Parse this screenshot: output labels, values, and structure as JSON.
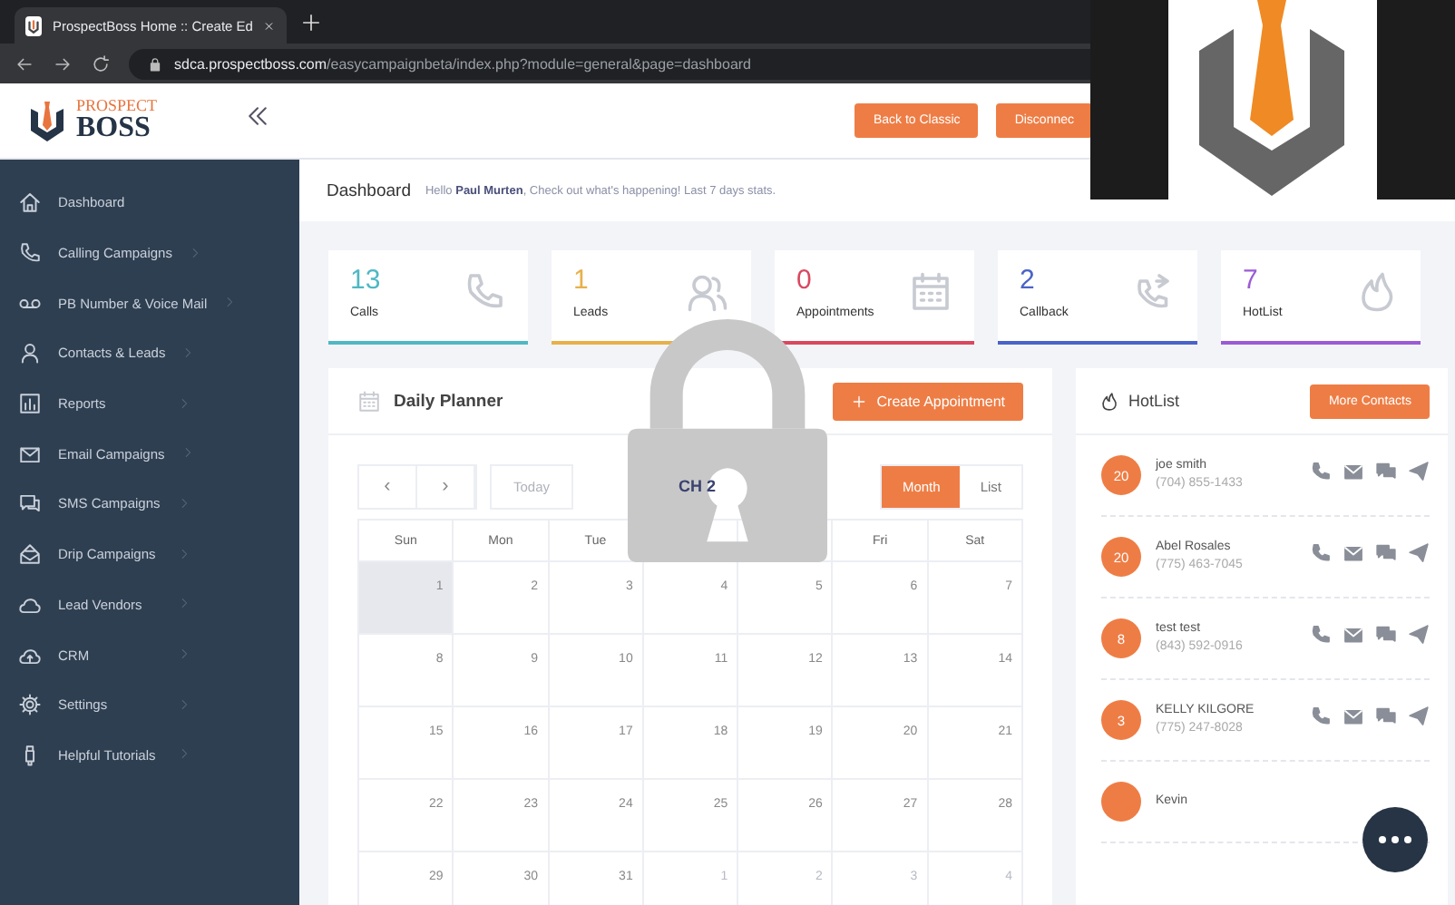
{
  "browser": {
    "tab_title": "ProspectBoss Home :: Create Ed",
    "url_host": "sdca.prospectboss.com",
    "url_path": "/easycampaignbeta/index.php?module=general&page=dashboard"
  },
  "header": {
    "logo_top": "PROSPECT",
    "logo_bottom": "BOSS",
    "buttons": [
      "Back to Classic",
      "Disconnec"
    ]
  },
  "sidebar": {
    "items": [
      {
        "label": "Dashboard",
        "submenu": false
      },
      {
        "label": "Calling Campaigns",
        "submenu": true
      },
      {
        "label": "PB Number & Voice Mail",
        "submenu": true
      },
      {
        "label": "Contacts & Leads",
        "submenu": true
      },
      {
        "label": "Reports",
        "submenu": true
      },
      {
        "label": "Email Campaigns",
        "submenu": true
      },
      {
        "label": "SMS Campaigns",
        "submenu": true
      },
      {
        "label": "Drip Campaigns",
        "submenu": true
      },
      {
        "label": "Lead Vendors",
        "submenu": true
      },
      {
        "label": "CRM",
        "submenu": true
      },
      {
        "label": "Settings",
        "submenu": true
      },
      {
        "label": "Helpful Tutorials",
        "submenu": true
      }
    ]
  },
  "page": {
    "title": "Dashboard",
    "greeting": "Hello **Paul Murten**, Check out what's happening! Last 7 days stats."
  },
  "stats": [
    {
      "value": "13",
      "label": "Calls",
      "color": "#4fb8c4"
    },
    {
      "value": "1",
      "label": "Leads",
      "color": "#e8b04a"
    },
    {
      "value": "0",
      "label": "Appointments",
      "color": "#d9485f"
    },
    {
      "value": "2",
      "label": "Callback",
      "color": "#4a63c8"
    },
    {
      "value": "7",
      "label": "HotList",
      "color": "#9b5bd6"
    }
  ],
  "planner": {
    "title": "Daily Planner",
    "create_button": "Create Appointment",
    "prev": "‹",
    "next": "›",
    "today": "Today",
    "month_title": "CH 2",
    "views": [
      {
        "label": "Month",
        "selected": true
      },
      {
        "label": "List",
        "selected": false
      }
    ],
    "weekdays_left": [
      "Sun",
      "Mon",
      "Tue"
    ],
    "weekdays_right": [
      "Fri",
      "Sat"
    ],
    "weeks": [
      [
        {
          "day": "1",
          "today": true,
          "muted": false
        },
        {
          "day": "2",
          "today": false,
          "muted": false
        },
        {
          "day": "3",
          "today": false,
          "muted": false
        },
        {
          "day": "4",
          "today": false,
          "muted": false
        },
        {
          "day": "5",
          "today": false,
          "muted": false
        },
        {
          "day": "6",
          "today": false,
          "muted": false
        },
        {
          "day": "7",
          "today": false,
          "muted": false
        }
      ],
      [
        {
          "day": "8",
          "today": false,
          "muted": false
        },
        {
          "day": "9",
          "today": false,
          "muted": false
        },
        {
          "day": "10",
          "today": false,
          "muted": false
        },
        {
          "day": "11",
          "today": false,
          "muted": false
        },
        {
          "day": "12",
          "today": false,
          "muted": false
        },
        {
          "day": "13",
          "today": false,
          "muted": false
        },
        {
          "day": "14",
          "today": false,
          "muted": false
        }
      ],
      [
        {
          "day": "15",
          "today": false,
          "muted": false
        },
        {
          "day": "16",
          "today": false,
          "muted": false
        },
        {
          "day": "17",
          "today": false,
          "muted": false
        },
        {
          "day": "18",
          "today": false,
          "muted": false
        },
        {
          "day": "19",
          "today": false,
          "muted": false
        },
        {
          "day": "20",
          "today": false,
          "muted": false
        },
        {
          "day": "21",
          "today": false,
          "muted": false
        }
      ],
      [
        {
          "day": "22",
          "today": false,
          "muted": false
        },
        {
          "day": "23",
          "today": false,
          "muted": false
        },
        {
          "day": "24",
          "today": false,
          "muted": false
        },
        {
          "day": "25",
          "today": false,
          "muted": false
        },
        {
          "day": "26",
          "today": false,
          "muted": false
        },
        {
          "day": "27",
          "today": false,
          "muted": false
        },
        {
          "day": "28",
          "today": false,
          "muted": false
        }
      ],
      [
        {
          "day": "29",
          "today": false,
          "muted": false
        },
        {
          "day": "30",
          "today": false,
          "muted": false
        },
        {
          "day": "31",
          "today": false,
          "muted": false
        },
        {
          "day": "1",
          "today": false,
          "muted": true
        },
        {
          "day": "2",
          "today": false,
          "muted": true
        },
        {
          "day": "3",
          "today": false,
          "muted": true
        },
        {
          "day": "4",
          "today": false,
          "muted": true
        }
      ]
    ]
  },
  "hotlist": {
    "title": "HotList",
    "more_button": "More Contacts",
    "contacts": [
      {
        "score": "20",
        "name": "joe smith",
        "phone": "(704) 855-1433"
      },
      {
        "score": "20",
        "name": "Abel Rosales",
        "phone": "(775) 463-7045"
      },
      {
        "score": "8",
        "name": "test test",
        "phone": "(843) 592-0916"
      },
      {
        "score": "3",
        "name": "KELLY KILGORE",
        "phone": "(775) 247-8028"
      },
      {
        "name": "Kevin"
      }
    ]
  }
}
